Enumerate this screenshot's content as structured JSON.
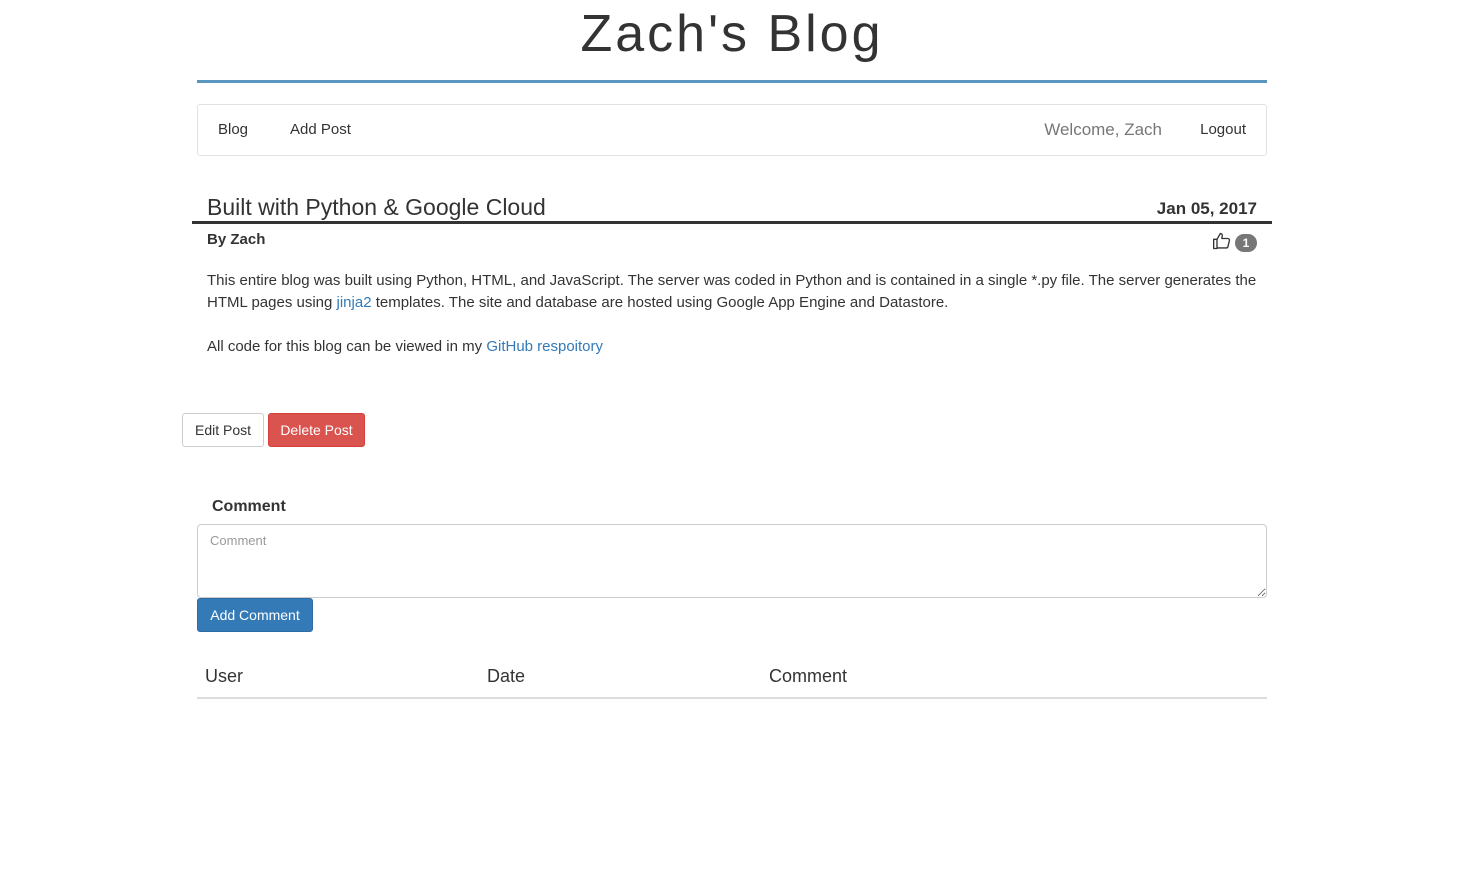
{
  "site": {
    "title": "Zach's Blog",
    "accent_color": "#5b95c1"
  },
  "nav": {
    "blog": "Blog",
    "add_post": "Add Post",
    "welcome": "Welcome, Zach",
    "logout": "Logout"
  },
  "post": {
    "title": "Built with Python & Google Cloud",
    "date": "Jan 05, 2017",
    "author": "By Zach",
    "like_icon": "thumbs-up-icon",
    "like_count": "1",
    "paragraph1": {
      "text_before": "This entire blog was built using Python, HTML, and JavaScript. The server was coded in Python and is contained in a single *.py file. The server generates the HTML pages using ",
      "link": "jinja2",
      "text_after": " templates. The site and database are hosted using Google App Engine and Datastore."
    },
    "paragraph2": {
      "text_before": "All code for this blog can be viewed in my ",
      "link": "GitHub respoitory"
    }
  },
  "actions": {
    "edit": "Edit Post",
    "delete": "Delete Post",
    "delete_color": "#d9534f"
  },
  "comment_form": {
    "label": "Comment",
    "placeholder": "Comment",
    "value": "",
    "submit": "Add Comment",
    "submit_color": "#337ab7"
  },
  "comments_table": {
    "headers": [
      "User",
      "Date",
      "Comment"
    ],
    "rows": []
  }
}
